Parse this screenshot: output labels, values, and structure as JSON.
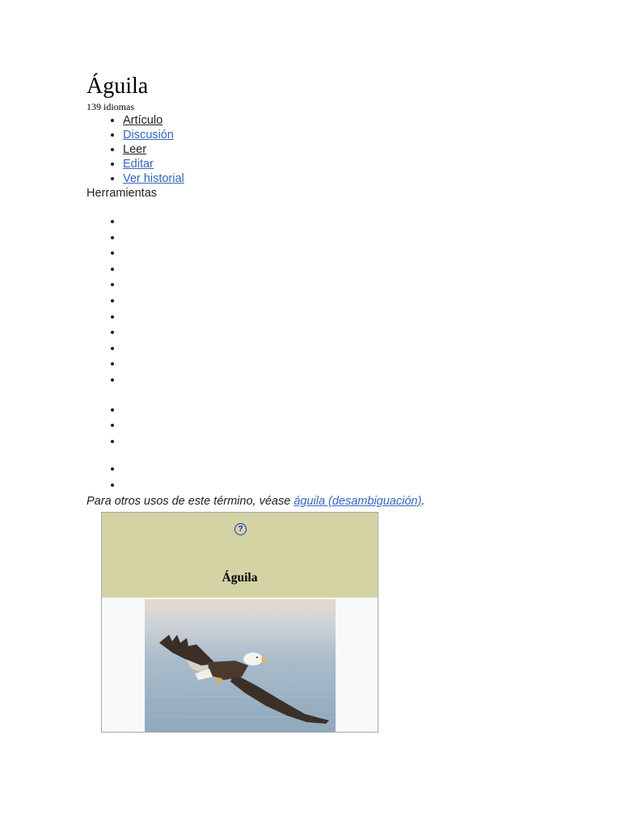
{
  "article": {
    "title": "Águila",
    "languages": "139 idiomas"
  },
  "tabs": [
    {
      "label": "Artículo",
      "current": true
    },
    {
      "label": "Discusión",
      "current": false
    },
    {
      "label": "Leer",
      "current": true
    },
    {
      "label": "Editar",
      "current": false
    },
    {
      "label": "Ver historial",
      "current": false
    }
  ],
  "tools": {
    "label": "Herramientas"
  },
  "hatnote": {
    "prefix": "Para otros usos de este término, véase ",
    "link_text": "águila (desambiguación)",
    "suffix": "."
  },
  "infobox": {
    "help_icon": "help-icon",
    "title": "Águila",
    "image": "bald-eagle-in-flight"
  },
  "colors": {
    "link": "#3366cc",
    "infobox_header": "#d3d3a4",
    "infobox_border": "#a2a9b1"
  }
}
